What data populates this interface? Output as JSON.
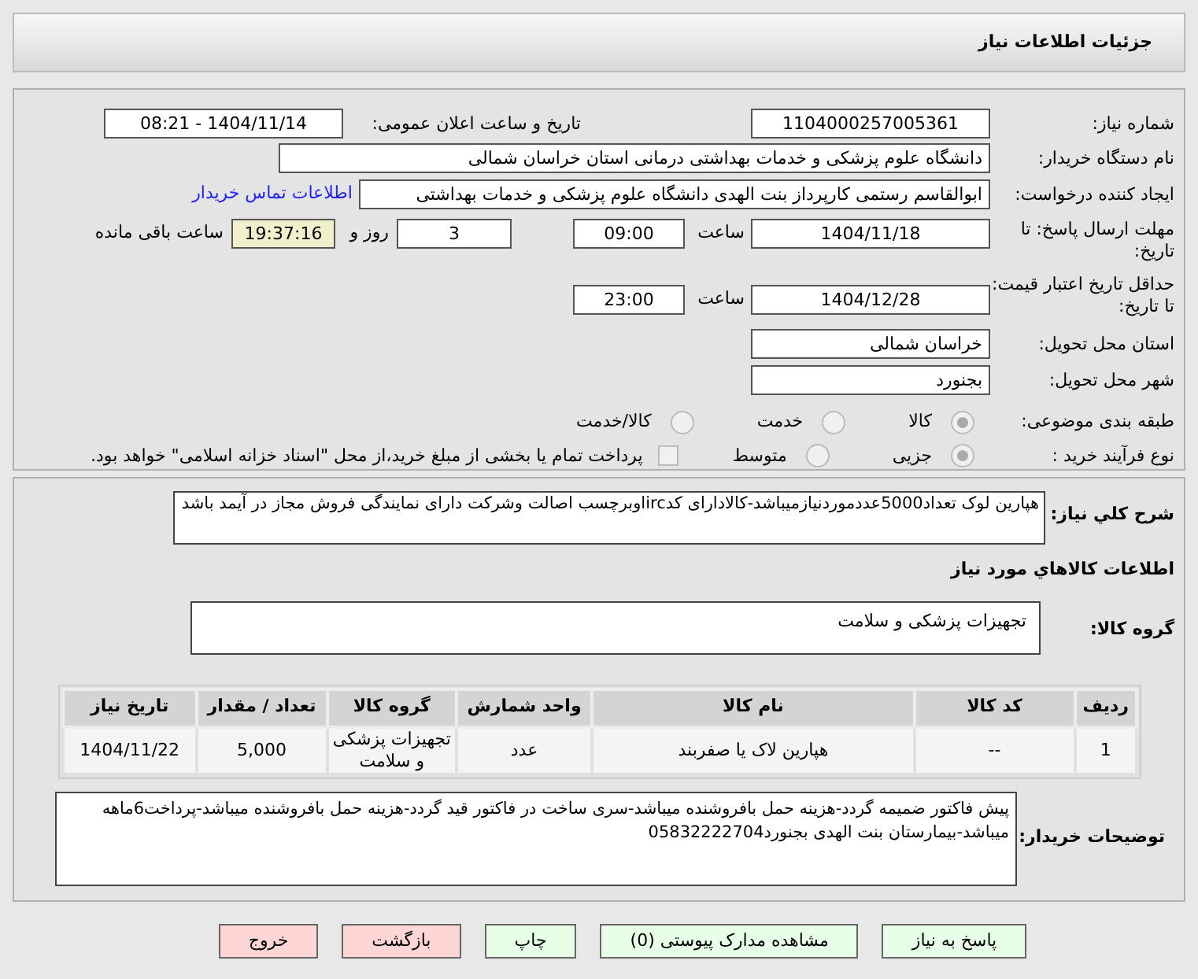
{
  "header": {
    "title": "جزئیات اطلاعات نیاز"
  },
  "need_number": {
    "label": "شماره نیاز:",
    "value": "1104000257005361"
  },
  "announce": {
    "label": "تاریخ و ساعت اعلان عمومی:",
    "value": "1404/11/14 - 08:21"
  },
  "buyer": {
    "label": "نام دستگاه خریدار:",
    "value": "دانشگاه علوم پزشکی و خدمات بهداشتی درمانی استان خراسان شمالی"
  },
  "requester": {
    "label": "ایجاد کننده درخواست:",
    "value": "ابوالقاسم رستمی کارپرداز بنت الهدی دانشگاه علوم پزشکی و خدمات بهداشتی",
    "link": "اطلاعات تماس خریدار"
  },
  "deadline": {
    "label": "مهلت ارسال پاسخ: تا تاریخ:",
    "date": "1404/11/18",
    "time_label": "ساعت",
    "time": "09:00",
    "days": "3",
    "days_label": "روز و",
    "remaining": "19:37:16",
    "remaining_label": "ساعت باقی مانده"
  },
  "validity": {
    "label": "حداقل تاریخ اعتبار قیمت: تا تاریخ:",
    "date": "1404/12/28",
    "time_label": "ساعت",
    "time": "23:00"
  },
  "province": {
    "label": "استان محل تحویل:",
    "value": "خراسان شمالی"
  },
  "city": {
    "label": "شهر محل تحویل:",
    "value": "بجنورد"
  },
  "category": {
    "label": "طبقه بندی موضوعی:",
    "options": [
      {
        "label": "کالا",
        "selected": true
      },
      {
        "label": "خدمت",
        "selected": false
      },
      {
        "label": "کالا/خدمت",
        "selected": false
      }
    ]
  },
  "process": {
    "label": "نوع فرآیند خرید :",
    "options": [
      {
        "label": "جزیی",
        "selected": true
      },
      {
        "label": "متوسط",
        "selected": false
      }
    ],
    "payment": {
      "checked": false,
      "label": "پرداخت تمام یا بخشی از مبلغ خرید،از محل \"اسناد خزانه اسلامی\" خواهد بود."
    }
  },
  "description": {
    "label": "شرح کلي نياز:",
    "value": "هپارین لوک تعداد5000عددموردنیازمیباشد-کالادارای کدircاوبرچسب اصالت وشرکت دارای نمایندگی فروش مجاز در آیمد باشد"
  },
  "goods_heading": "اطلاعات کالاهاي مورد نياز",
  "goods_group": {
    "label": "گروه کالا:",
    "value": "تجهیزات پزشکی و سلامت"
  },
  "table": {
    "columns": [
      "ردیف",
      "کد کالا",
      "نام کالا",
      "واحد شمارش",
      "گروه کالا",
      "تعداد / مقدار",
      "تاریخ نیاز"
    ],
    "rows": [
      [
        "1",
        "--",
        "هپارین لاک یا صفربند",
        "عدد",
        "تجهیزات پزشکی و سلامت",
        "5,000",
        "1404/11/22"
      ]
    ]
  },
  "buyer_notes": {
    "label": "توضیحات خریدار:",
    "value": "پیش فاکتور ضمیمه گردد-هزینه حمل بافروشنده میباشد-سری ساخت در فاکتور قید گردد-هزینه حمل بافروشنده میباشد-پرداخت6ماهه میباشد-بیمارستان بنت الهدی بجنورد05832222704"
  },
  "buttons": [
    {
      "label": "پاسخ به نیاز",
      "kind": "primary"
    },
    {
      "label": "مشاهده مدارک پیوستی (0)",
      "kind": "primary"
    },
    {
      "label": "چاپ",
      "kind": "primary"
    },
    {
      "label": "بازگشت",
      "kind": "danger"
    },
    {
      "label": "خروج",
      "kind": "danger"
    }
  ]
}
